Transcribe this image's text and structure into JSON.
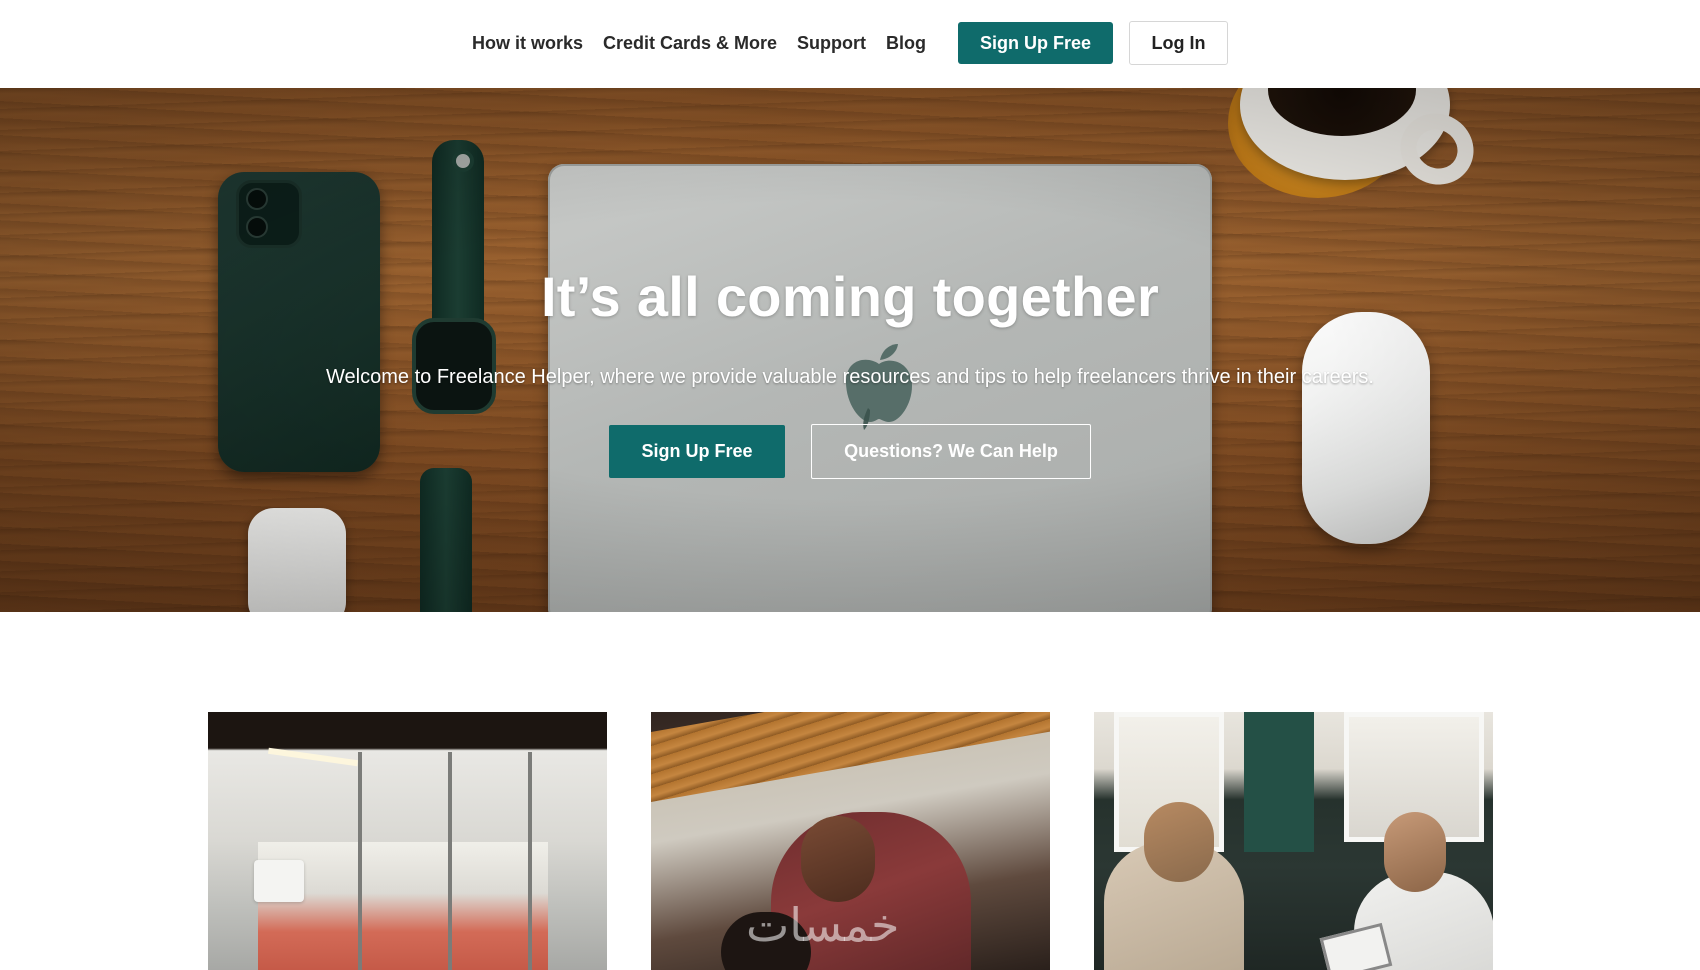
{
  "nav": {
    "links": [
      "How it works",
      "Credit Cards & More",
      "Support",
      "Blog"
    ],
    "signup_label": "Sign Up Free",
    "login_label": "Log In"
  },
  "hero": {
    "title": "It’s all coming together",
    "subtitle": "Welcome to Freelance Helper, where we provide valuable resources and tips to help freelancers thrive in their careers.",
    "primary_cta": "Sign Up Free",
    "secondary_cta": "Questions? We Can Help"
  },
  "cards": [
    {
      "image": "office-interior-photo"
    },
    {
      "image": "man-working-photo"
    },
    {
      "image": "team-meeting-photo"
    }
  ],
  "watermark": "خمسات",
  "colors": {
    "accent": "#0f6b6b",
    "background": "#ffffff",
    "text": "#2a2a2a"
  }
}
